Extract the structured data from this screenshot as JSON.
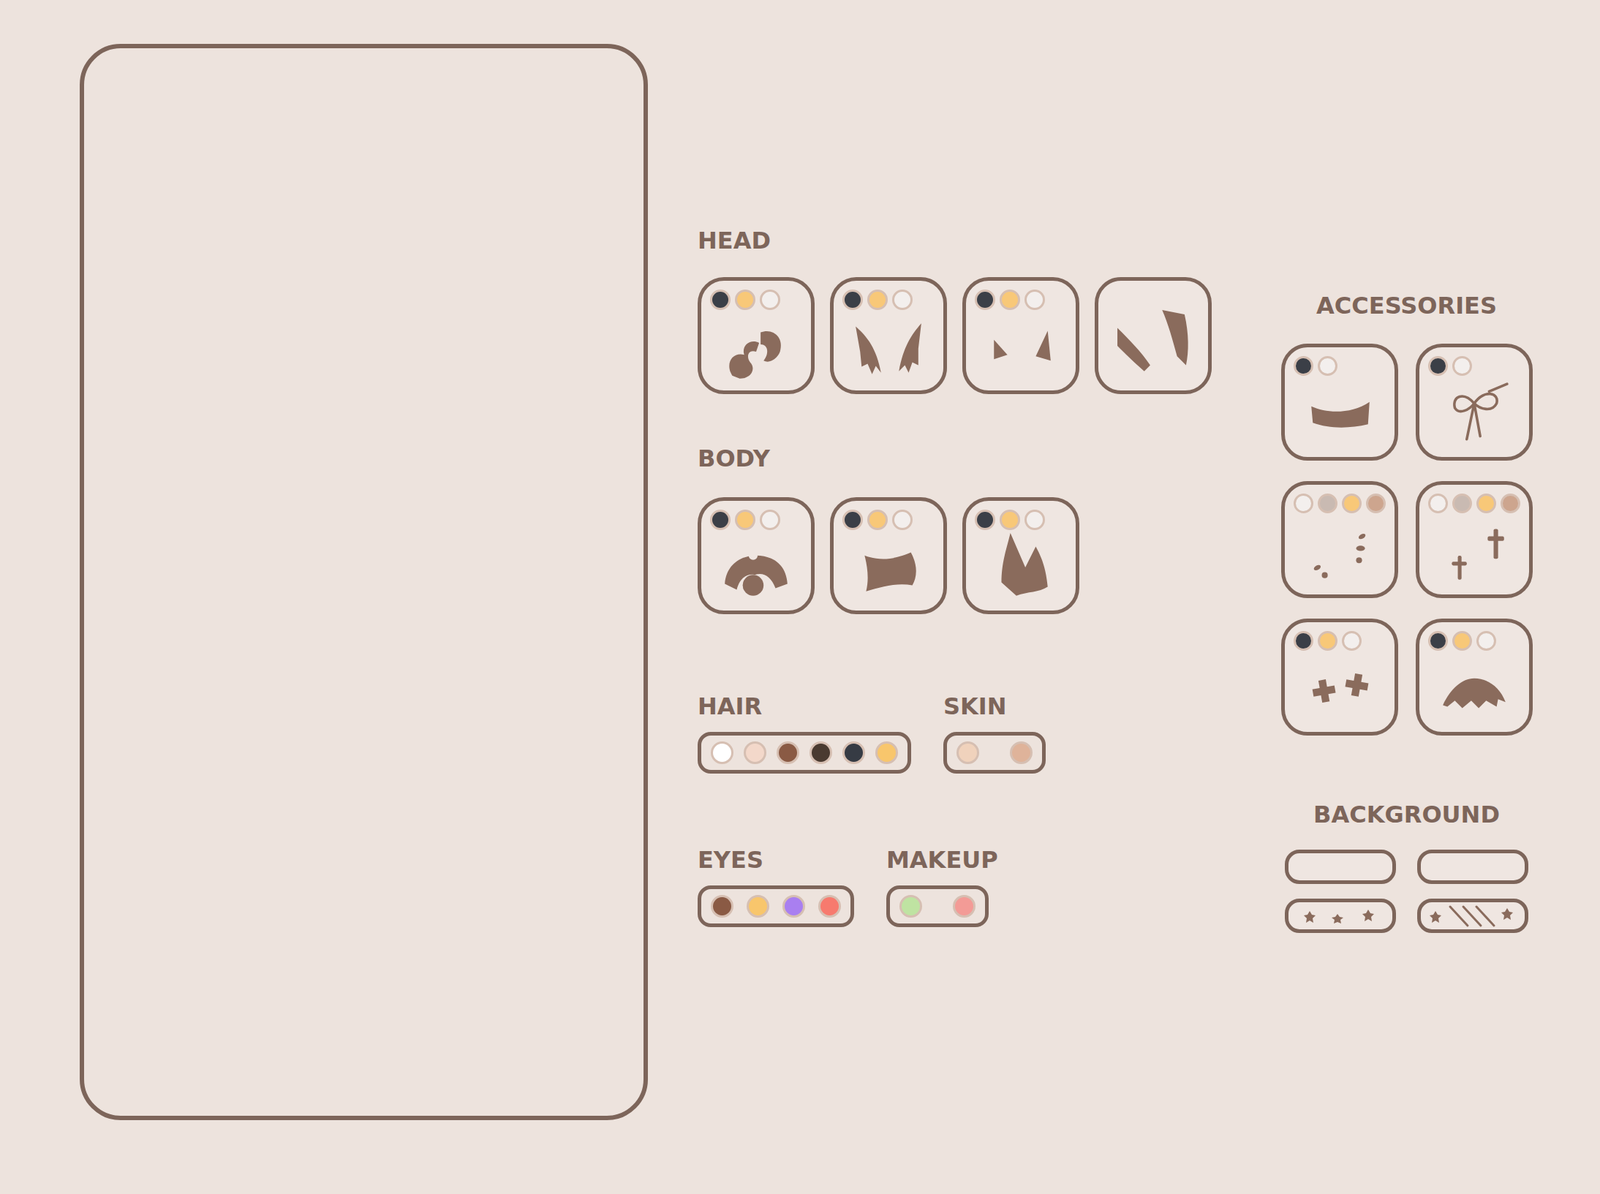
{
  "head": {
    "label": "HEAD",
    "items": [
      {
        "kind": "buns",
        "selected": false,
        "colors": [
          {
            "color": "#3b3f47",
            "selected": false
          },
          {
            "color": "#f8c878",
            "selected": false
          },
          {
            "color": "#f3efed",
            "selected": false
          }
        ]
      },
      {
        "kind": "wings",
        "selected": false,
        "colors": [
          {
            "color": "#3b3f47",
            "selected": false
          },
          {
            "color": "#f8c878",
            "selected": false
          },
          {
            "color": "#f3efed",
            "selected": false
          }
        ]
      },
      {
        "kind": "ears",
        "selected": false,
        "colors": [
          {
            "color": "#3b3f47",
            "selected": false
          },
          {
            "color": "#f8c878",
            "selected": false
          },
          {
            "color": "#f3efed",
            "selected": false
          }
        ]
      },
      {
        "kind": "hair",
        "selected": false,
        "colors": []
      }
    ]
  },
  "body": {
    "label": "BODY",
    "items": [
      {
        "kind": "hoodie",
        "selected": false,
        "colors": [
          {
            "color": "#3b3f47",
            "selected": false
          },
          {
            "color": "#f8c878",
            "selected": false
          },
          {
            "color": "#f3efed",
            "selected": false
          }
        ]
      },
      {
        "kind": "top",
        "selected": false,
        "colors": [
          {
            "color": "#3b3f47",
            "selected": false
          },
          {
            "color": "#f8c878",
            "selected": false
          },
          {
            "color": "#f3efed",
            "selected": false
          }
        ]
      },
      {
        "kind": "dress",
        "selected": false,
        "colors": [
          {
            "color": "#3b3f47",
            "selected": false
          },
          {
            "color": "#f8c878",
            "selected": false
          },
          {
            "color": "#f3efed",
            "selected": false
          }
        ]
      }
    ]
  },
  "swatch_rows": [
    [
      {
        "label": "HAIR",
        "colors": [
          {
            "color": "#ffffff",
            "selected": false
          },
          {
            "color": "#f3d8ca",
            "selected": false
          },
          {
            "color": "#8a5a44",
            "selected": false
          },
          {
            "color": "#4a3a30",
            "selected": false
          },
          {
            "color": "#363b44",
            "selected": false
          },
          {
            "color": "#f8c66c",
            "selected": false
          }
        ]
      },
      {
        "label": "SKIN",
        "colors": [
          {
            "color": "#f0d2bc",
            "selected": false
          },
          {
            "color": "#dfb39a",
            "selected": false
          }
        ]
      }
    ],
    [
      {
        "label": "EYES",
        "colors": [
          {
            "color": "#8a5a44",
            "selected": false
          },
          {
            "color": "#f8c66c",
            "selected": false
          },
          {
            "color": "#a97ff0",
            "selected": false
          },
          {
            "color": "#f77a6e",
            "selected": false
          }
        ]
      },
      {
        "label": "MAKEUP",
        "colors": [
          {
            "color": "#bfe3a2",
            "selected": false
          },
          {
            "color": "#f39b96",
            "selected": false
          }
        ]
      }
    ]
  ],
  "accessories": {
    "label": "ACCESSORIES",
    "items": [
      {
        "kind": "mask",
        "selected": false,
        "colors": [
          {
            "color": "#3b3f47",
            "selected": false
          },
          {
            "color": "#f3efed",
            "selected": false
          }
        ]
      },
      {
        "kind": "bow",
        "selected": false,
        "colors": [
          {
            "color": "#3b3f47",
            "selected": false
          },
          {
            "color": "#f3efed",
            "selected": false
          }
        ]
      },
      {
        "kind": "blush",
        "selected": false,
        "colors": [
          {
            "color": "#f3efed",
            "selected": false
          },
          {
            "color": "#c9bab2",
            "selected": false
          },
          {
            "color": "#f8c878",
            "selected": false
          },
          {
            "color": "#cda58e",
            "selected": false
          }
        ]
      },
      {
        "kind": "crosses",
        "selected": false,
        "colors": [
          {
            "color": "#f3efed",
            "selected": false
          },
          {
            "color": "#c9bab2",
            "selected": false
          },
          {
            "color": "#f8c878",
            "selected": false
          },
          {
            "color": "#cda58e",
            "selected": false
          }
        ]
      },
      {
        "kind": "bandages",
        "selected": false,
        "colors": [
          {
            "color": "#3b3f47",
            "selected": false
          },
          {
            "color": "#f8c878",
            "selected": false
          },
          {
            "color": "#f3efed",
            "selected": false
          }
        ]
      },
      {
        "kind": "cape",
        "selected": false,
        "colors": [
          {
            "color": "#3b3f47",
            "selected": false
          },
          {
            "color": "#f8c878",
            "selected": false
          },
          {
            "color": "#f3efed",
            "selected": false
          }
        ]
      }
    ]
  },
  "background": {
    "label": "BACKGROUND",
    "items": [
      {
        "kind": "plain",
        "selected": false
      },
      {
        "kind": "plain",
        "selected": false
      },
      {
        "kind": "stars",
        "selected": false
      },
      {
        "kind": "stripes",
        "selected": false
      }
    ]
  }
}
